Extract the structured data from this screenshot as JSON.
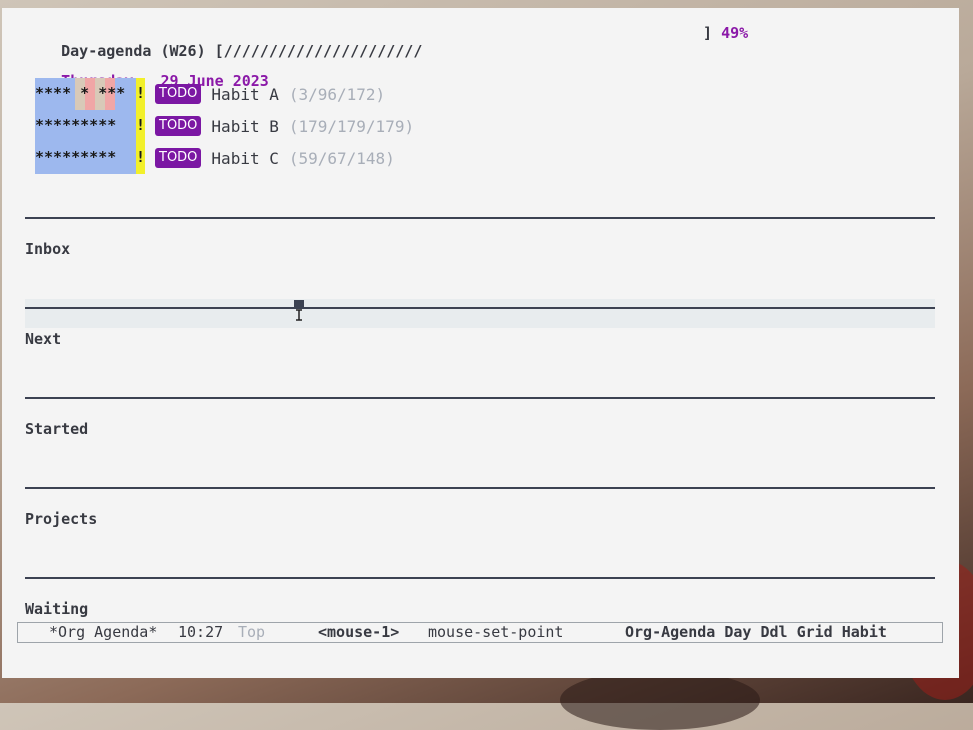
{
  "agenda": {
    "header_label": "Day-agenda (W26)",
    "progress_bar": "[//////////////////////",
    "progress_close": "]",
    "progress_percent": "49%",
    "progress_fraction": 0.49,
    "date_weekday": "Thursday",
    "date_full": "29 June 2023"
  },
  "habits": [
    {
      "graph": "**** * ***",
      "flag": "!",
      "state": "TODO",
      "name": "Habit A",
      "count": "(3/96/172)"
    },
    {
      "graph": "*********",
      "flag": "!",
      "state": "TODO",
      "name": "Habit B",
      "count": "(179/179/179)"
    },
    {
      "graph": "*********",
      "flag": "!",
      "state": "TODO",
      "name": "Habit C",
      "count": "(59/67/148)"
    }
  ],
  "sections": [
    "Inbox",
    "Next",
    "Started",
    "Projects",
    "Waiting"
  ],
  "modeline": {
    "buffer": "*Org Agenda*",
    "time": "10:27",
    "position": "Top",
    "key": "<mouse-1>",
    "command": "mouse-set-point",
    "modes": "Org-Agenda Day Ddl Grid Habit"
  },
  "colors": {
    "accent": "#8b19a8",
    "todo_bg": "#7b17a3",
    "habit_graph": "#9db8ee",
    "habit_today": "#f2f02a",
    "dim_text": "#a8aeb8"
  },
  "icons": {
    "cursor": "i-beam-cursor-icon"
  }
}
